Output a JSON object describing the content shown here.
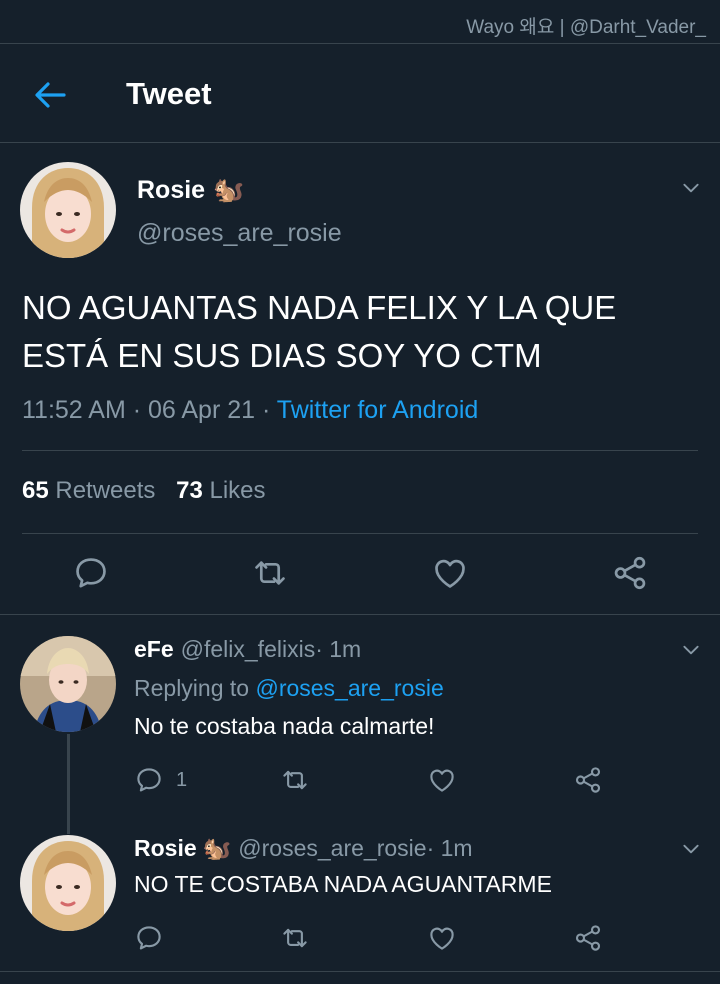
{
  "watermark": "Wayo 왜요 | @Darht_Vader_",
  "header": {
    "title": "Tweet"
  },
  "main_tweet": {
    "author_name": "Rosie",
    "author_emoji": "🐿️",
    "author_handle": "@roses_are_rosie",
    "text": "NO AGUANTAS NADA FELIX Y LA QUE ESTÁ EN SUS DIAS SOY YO CTM",
    "time": "11:52 AM · 06 Apr 21 · ",
    "source": "Twitter for Android",
    "retweets_count": "65",
    "retweets_label": "Retweets",
    "likes_count": "73",
    "likes_label": "Likes"
  },
  "replies": [
    {
      "author_name": "eFe",
      "author_handle": "@felix_felixis",
      "time": " · 1m",
      "replying_label": "Replying to ",
      "replying_to": "@roses_are_rosie",
      "text": "No te costaba nada calmarte!",
      "reply_count": "1"
    },
    {
      "author_name": "Rosie",
      "author_emoji": "🐿️",
      "author_handle": "@roses_are_rosie",
      "time": " · 1m",
      "text": "NO TE COSTABA NADA AGUANTARME",
      "reply_count": ""
    }
  ],
  "colors": {
    "background": "#15202b",
    "divider": "#38444d",
    "muted": "#8899a6",
    "accent": "#1da1f2"
  }
}
